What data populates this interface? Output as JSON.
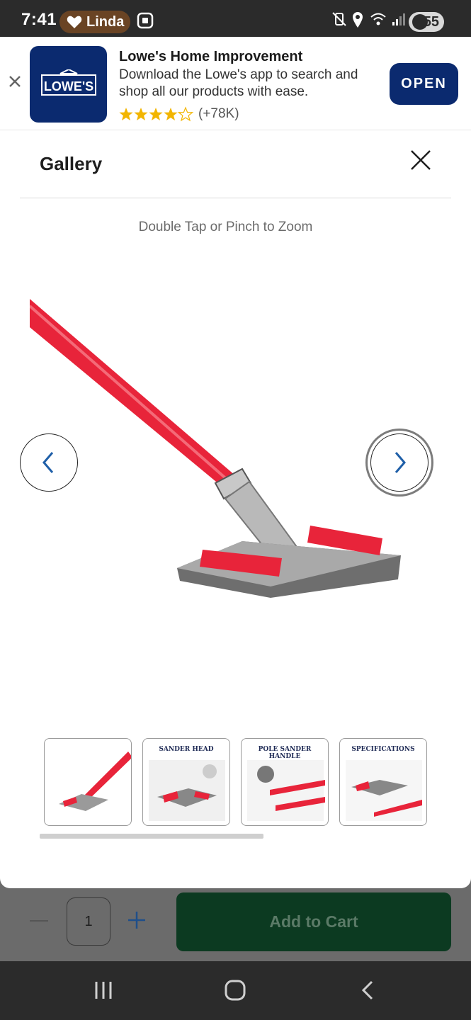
{
  "status_bar": {
    "time": "7:41",
    "user": "Linda",
    "battery": "55",
    "icons": [
      "heart-icon",
      "screenshot-icon",
      "mute-vibrate-icon",
      "location-icon",
      "wifi-icon",
      "signal-icon",
      "battery-saver-icon"
    ]
  },
  "app_banner": {
    "title": "Lowe's Home Improvement",
    "description": "Download the Lowe's app to search and shop all our products with ease.",
    "rating": 4.5,
    "rating_count": "(+78K)",
    "open_label": "OPEN",
    "logo_text": "LOWE'S",
    "brand_color": "#0b2a6f",
    "star_color": "#f2b500"
  },
  "gallery": {
    "title": "Gallery",
    "zoom_hint": "Double Tap or Pinch to Zoom",
    "thumbnails": [
      {
        "label": ""
      },
      {
        "label": "SANDER HEAD"
      },
      {
        "label": "POLE SANDER HANDLE"
      },
      {
        "label": "SPECIFICATIONS"
      }
    ]
  },
  "cart": {
    "quantity": "1",
    "add_label": "Add to Cart",
    "button_color": "#0c3a21"
  },
  "android_nav": {
    "icons": [
      "recents-icon",
      "home-icon",
      "back-icon"
    ]
  }
}
